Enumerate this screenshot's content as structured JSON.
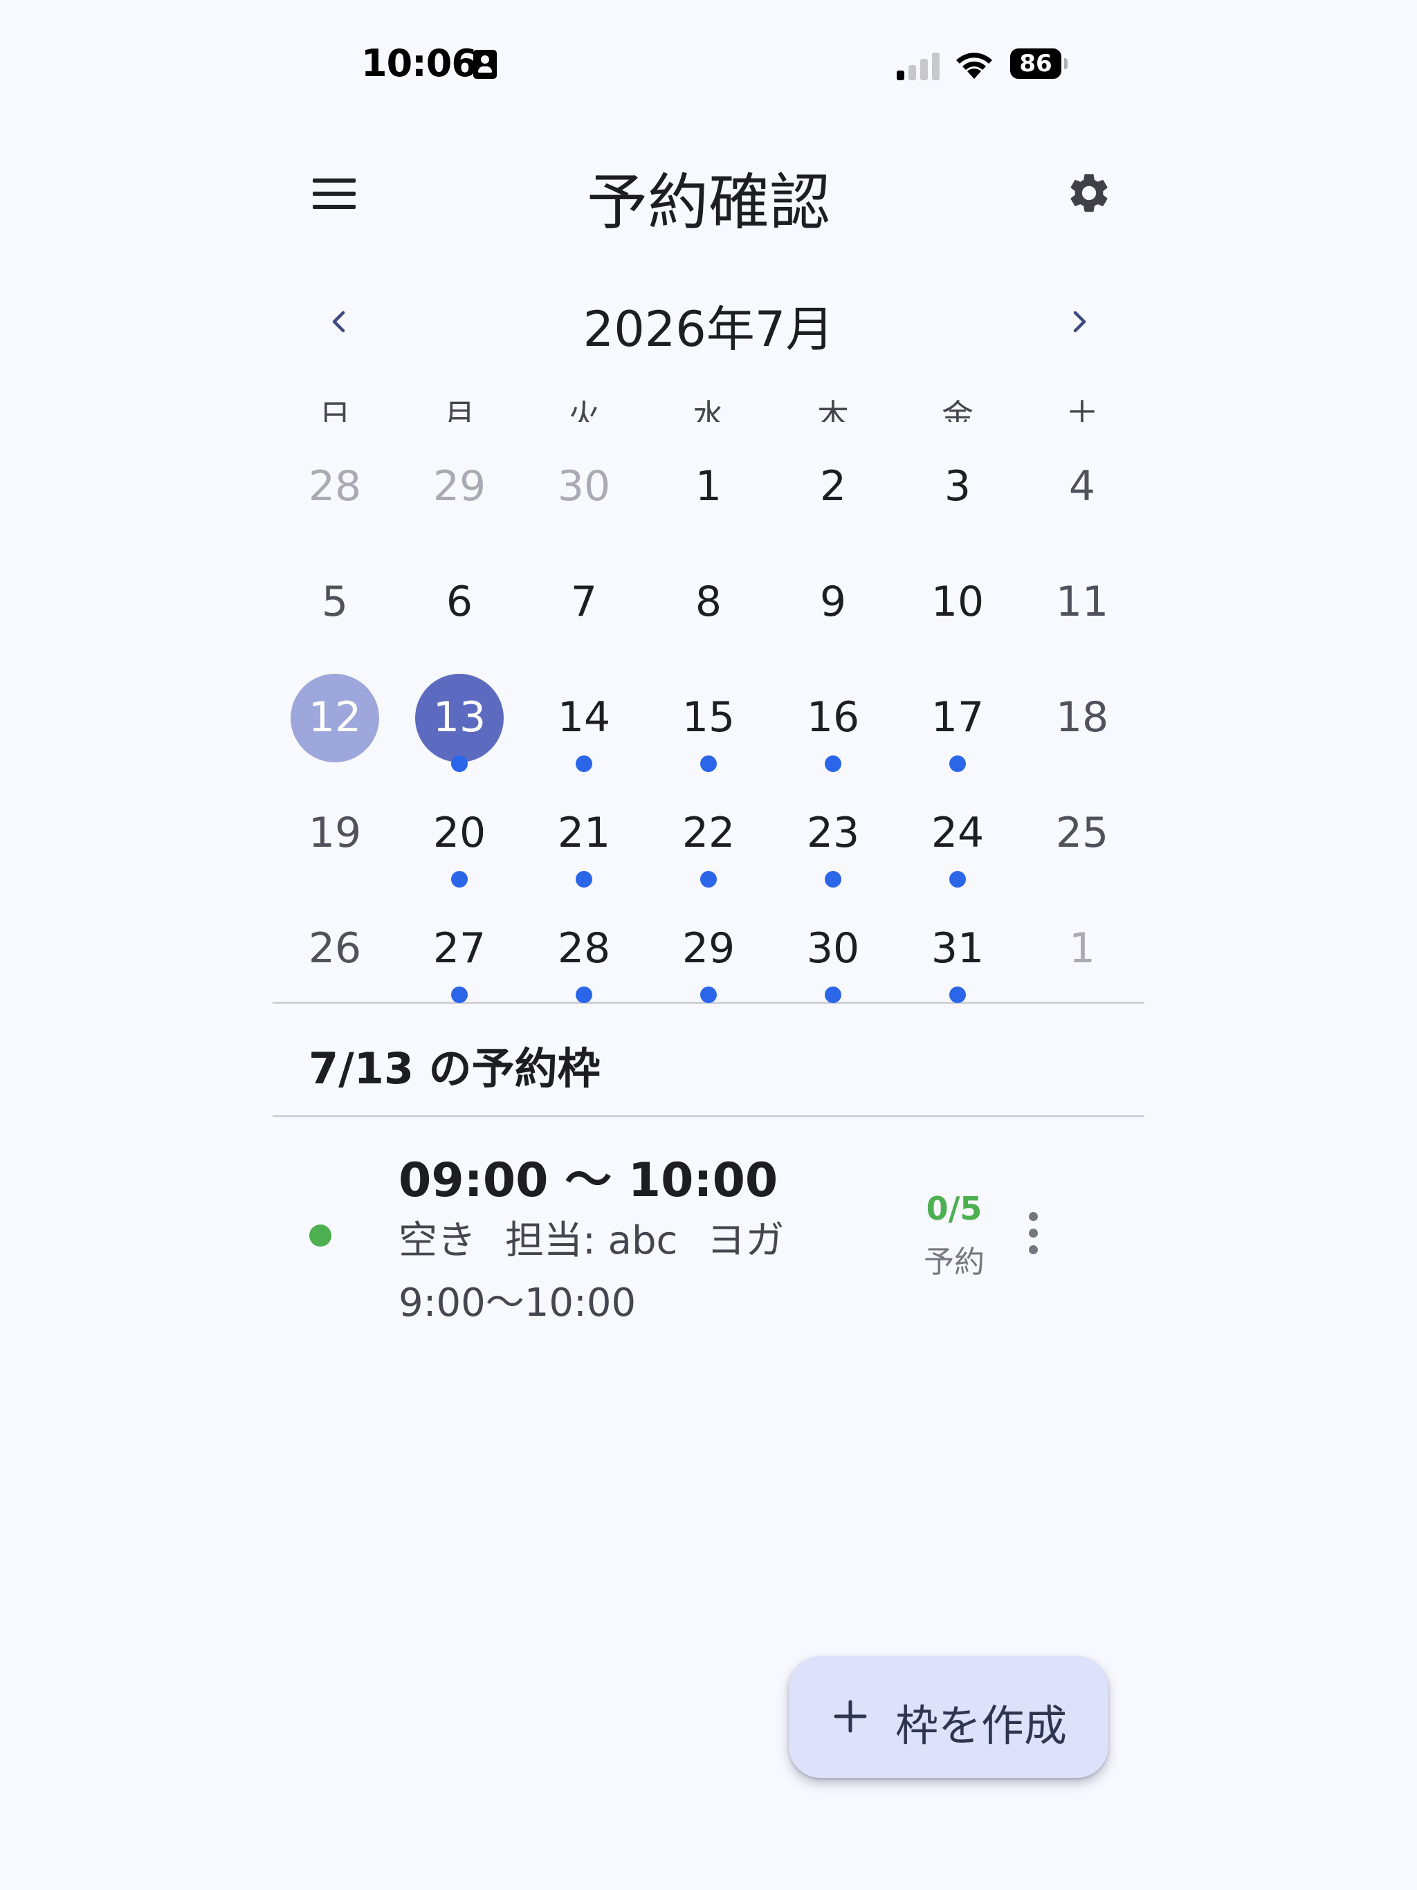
{
  "status_bar": {
    "time": "10:06",
    "battery": "86"
  },
  "header": {
    "title": "予約確認"
  },
  "calendar": {
    "month_label": "2026年7月",
    "weekdays": [
      "日",
      "月",
      "火",
      "水",
      "木",
      "金",
      "土"
    ],
    "weeks": [
      [
        {
          "day": "28",
          "other": true
        },
        {
          "day": "29",
          "other": true
        },
        {
          "day": "30",
          "other": true
        },
        {
          "day": "1"
        },
        {
          "day": "2"
        },
        {
          "day": "3"
        },
        {
          "day": "4",
          "weekend": true
        }
      ],
      [
        {
          "day": "5",
          "weekend": true
        },
        {
          "day": "6"
        },
        {
          "day": "7"
        },
        {
          "day": "8"
        },
        {
          "day": "9"
        },
        {
          "day": "10"
        },
        {
          "day": "11",
          "weekend": true
        }
      ],
      [
        {
          "day": "12",
          "today": true
        },
        {
          "day": "13",
          "selected": true,
          "dot": true
        },
        {
          "day": "14",
          "dot": true
        },
        {
          "day": "15",
          "dot": true
        },
        {
          "day": "16",
          "dot": true
        },
        {
          "day": "17",
          "dot": true
        },
        {
          "day": "18",
          "weekend": true
        }
      ],
      [
        {
          "day": "19",
          "weekend": true
        },
        {
          "day": "20",
          "dot": true
        },
        {
          "day": "21",
          "dot": true
        },
        {
          "day": "22",
          "dot": true
        },
        {
          "day": "23",
          "dot": true
        },
        {
          "day": "24",
          "dot": true
        },
        {
          "day": "25",
          "weekend": true
        }
      ],
      [
        {
          "day": "26",
          "weekend": true
        },
        {
          "day": "27",
          "dot": true
        },
        {
          "day": "28",
          "dot": true
        },
        {
          "day": "29",
          "dot": true
        },
        {
          "day": "30",
          "dot": true
        },
        {
          "day": "31",
          "dot": true
        },
        {
          "day": "1",
          "other": true
        }
      ]
    ]
  },
  "slots": {
    "section_title": "7/13 の予約枠",
    "items": [
      {
        "time": "09:00 〜 10:00",
        "status": "空き",
        "staff": "担当: abc",
        "category": "ヨガ",
        "description": "9:00〜10:00",
        "count": "0/5",
        "count_label": "予約"
      }
    ]
  },
  "fab": {
    "label": "枠を作成"
  },
  "colors": {
    "background": "#f8f9fe",
    "selected": "#5c6bc0",
    "today": "#9da7dc",
    "event_dot": "#2c66e8",
    "available": "#4caf50",
    "fab": "#dde1fa"
  },
  "icons": {
    "menu": "menu-icon",
    "settings": "gear-icon",
    "prev": "chevron-left-icon",
    "next": "chevron-right-icon",
    "more": "more-vert-icon",
    "add": "plus-icon"
  }
}
